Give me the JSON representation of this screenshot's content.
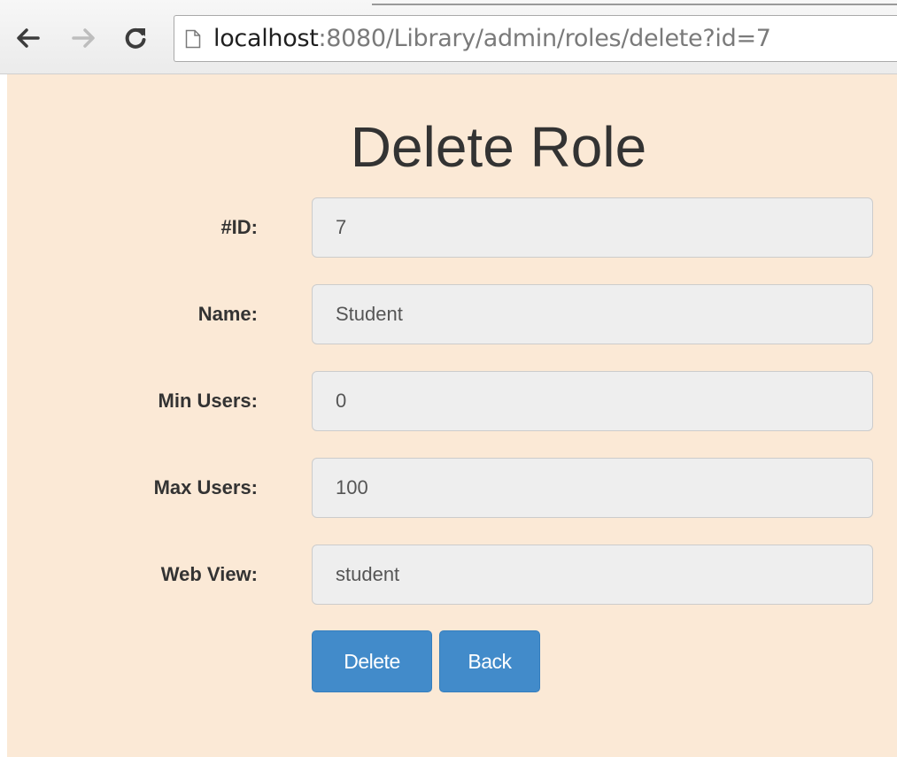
{
  "browser": {
    "url_host": "localhost",
    "url_path": ":8080/Library/admin/roles/delete?id=7"
  },
  "page": {
    "title": "Delete Role",
    "background": "#fbe9d6"
  },
  "form": {
    "fields": [
      {
        "label": "#ID:",
        "value": "7"
      },
      {
        "label": "Name:",
        "value": "Student"
      },
      {
        "label": "Min Users:",
        "value": "0"
      },
      {
        "label": "Max Users:",
        "value": "100"
      },
      {
        "label": "Web View:",
        "value": "student"
      }
    ]
  },
  "actions": {
    "delete_label": "Delete",
    "back_label": "Back",
    "button_color": "#428bca"
  },
  "icons": {
    "back": "arrow-left-icon",
    "forward": "arrow-right-icon",
    "reload": "reload-icon",
    "page": "page-icon"
  }
}
